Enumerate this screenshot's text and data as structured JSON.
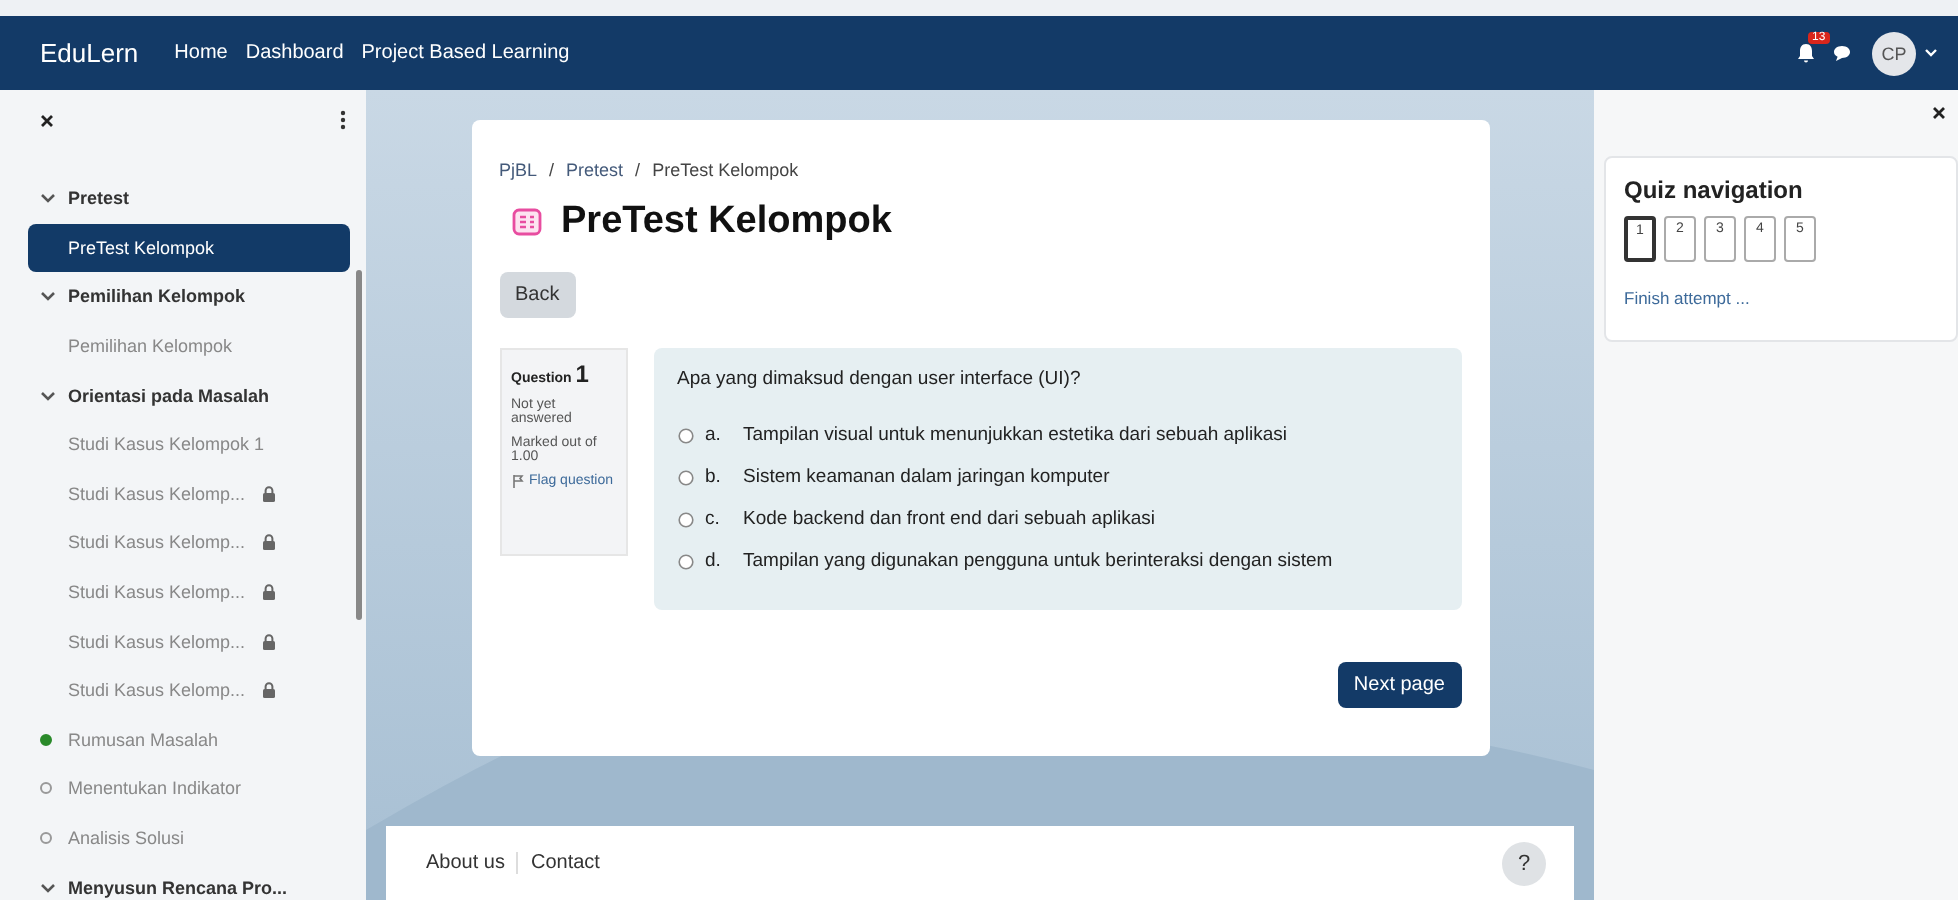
{
  "navbar": {
    "brand": "EduLern",
    "links": [
      "Home",
      "Dashboard",
      "Project Based Learning"
    ],
    "notification_count": "13",
    "avatar": "CP"
  },
  "sidebar": {
    "items": [
      {
        "kind": "section",
        "label": "Pretest",
        "expanded": true
      },
      {
        "kind": "activity",
        "label": "PreTest Kelompok",
        "selected": true,
        "locked": false
      },
      {
        "kind": "section",
        "label": "Pemilihan Kelompok",
        "expanded": true
      },
      {
        "kind": "activity",
        "label": "Pemilihan Kelompok",
        "selected": false,
        "locked": false
      },
      {
        "kind": "section",
        "label": "Orientasi pada Masalah",
        "expanded": true
      },
      {
        "kind": "activity",
        "label": "Studi Kasus Kelompok 1",
        "selected": false,
        "locked": false
      },
      {
        "kind": "activity",
        "label": "Studi Kasus Kelomp...",
        "selected": false,
        "locked": true
      },
      {
        "kind": "activity",
        "label": "Studi Kasus Kelomp...",
        "selected": false,
        "locked": true
      },
      {
        "kind": "activity",
        "label": "Studi Kasus Kelomp...",
        "selected": false,
        "locked": true
      },
      {
        "kind": "activity",
        "label": "Studi Kasus Kelomp...",
        "selected": false,
        "locked": true
      },
      {
        "kind": "activity",
        "label": "Studi Kasus Kelomp...",
        "selected": false,
        "locked": true
      },
      {
        "kind": "status",
        "label": "Rumusan Masalah",
        "completed": true
      },
      {
        "kind": "status",
        "label": "Menentukan Indikator",
        "completed": false
      },
      {
        "kind": "status",
        "label": "Analisis Solusi",
        "completed": false
      },
      {
        "kind": "section",
        "label": "Menyusun Rencana Pro...",
        "expanded": true
      }
    ]
  },
  "breadcrumb": {
    "separator": "/",
    "items": [
      "PjBL",
      "Pretest",
      "PreTest Kelompok"
    ]
  },
  "page_title": "PreTest Kelompok",
  "back_button": "Back",
  "question_info": {
    "label": "Question",
    "number": "1",
    "state": "Not yet answered",
    "mark": "Marked out of 1.00",
    "flag": "Flag question"
  },
  "question": {
    "text": "Apa yang dimaksud dengan user interface (UI)?",
    "options": [
      {
        "letter": "a.",
        "text": "Tampilan visual untuk menunjukkan estetika dari sebuah aplikasi",
        "selected": false
      },
      {
        "letter": "b.",
        "text": "Sistem keamanan dalam jaringan komputer",
        "selected": false
      },
      {
        "letter": "c.",
        "text": "Kode backend dan front end dari sebuah aplikasi",
        "selected": false
      },
      {
        "letter": "d.",
        "text": "Tampilan yang digunakan pengguna untuk berinteraksi dengan sistem",
        "selected": false
      }
    ]
  },
  "next_button": "Next page",
  "footer": {
    "links": [
      "About us",
      "Contact"
    ],
    "help": "?"
  },
  "quiz_navigation": {
    "title": "Quiz navigation",
    "questions": [
      {
        "number": "1",
        "selected": true
      },
      {
        "number": "2",
        "selected": false
      },
      {
        "number": "3",
        "selected": false
      },
      {
        "number": "4",
        "selected": false
      },
      {
        "number": "5",
        "selected": false
      }
    ],
    "finish": "Finish attempt ..."
  }
}
